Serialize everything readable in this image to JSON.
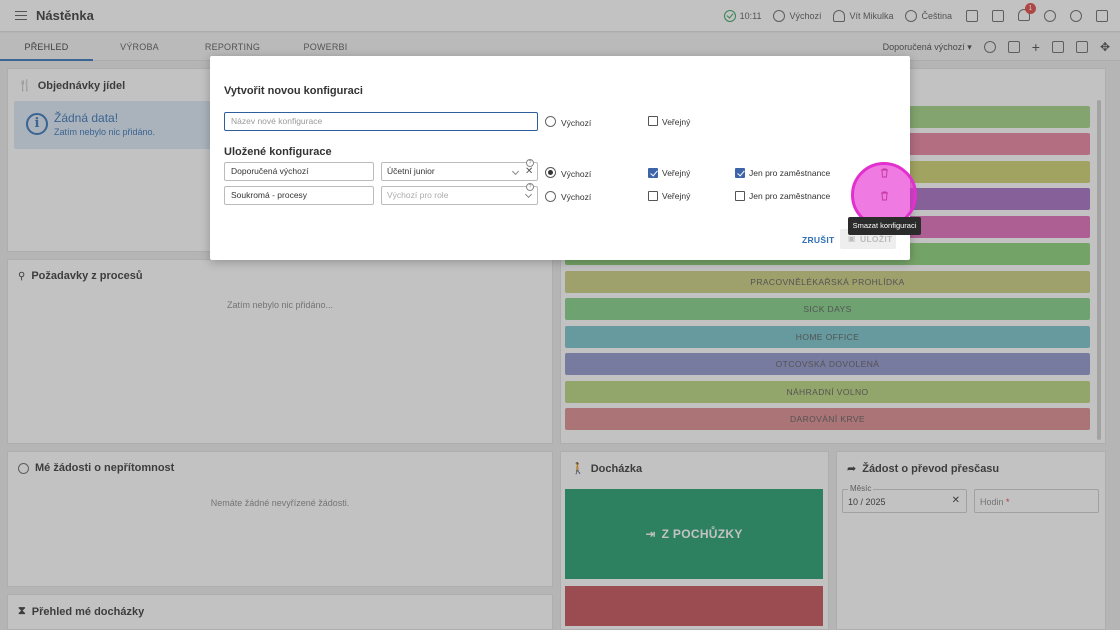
{
  "app": {
    "title": "Nástěnka"
  },
  "topbar": {
    "time": "10:11",
    "config_label": "Výchozí",
    "user": "Vít Mikulka",
    "language": "Čeština",
    "notifications_count": "1"
  },
  "tabs": [
    {
      "label": "PŘEHLED",
      "active": true
    },
    {
      "label": "VÝROBA",
      "active": false
    },
    {
      "label": "REPORTING",
      "active": false
    },
    {
      "label": "POWERBI",
      "active": false
    }
  ],
  "tab_right": {
    "config_select": "Doporučená výchozí"
  },
  "panels": {
    "orders": {
      "title": "Objednávky jídel",
      "info_title": "Žádná data!",
      "info_sub": "Zatím nebylo nic přidáno."
    },
    "requests": {
      "title": "Požadavky z procesů",
      "empty": "Zatím nebylo nic přidáno..."
    },
    "absence": {
      "title": "Mé žádosti o nepřítomnost",
      "empty": "Nemáte žádné nevyřízené žádosti."
    },
    "attendance_overview": {
      "title": "Přehled mé docházky"
    },
    "attendance": {
      "title": "Docházka",
      "button": "Z POCHŮZKY"
    },
    "overtime": {
      "title": "Žádost o převod přesčasu",
      "month_label": "Měsíc",
      "month_value": "10 / 2025",
      "hours_label": "Hodin",
      "required_mark": "*"
    }
  },
  "absence_types": [
    {
      "label": "",
      "color": "#9ed17f"
    },
    {
      "label": "",
      "color": "#e97e9c"
    },
    {
      "label": "",
      "color": "#cdd06a"
    },
    {
      "label": "",
      "color": "#a46bc0"
    },
    {
      "label": "",
      "color": "#df67b9"
    },
    {
      "label": "",
      "color": "#87cf73"
    },
    {
      "label": "PRACOVNĚLÉKAŘSKÁ PROHLÍDKA",
      "color": "#c8cd7c"
    },
    {
      "label": "SICK DAYS",
      "color": "#7fcf83"
    },
    {
      "label": "HOME OFFICE",
      "color": "#72c2c8"
    },
    {
      "label": "OTCOVSKÁ DOVOLENÁ",
      "color": "#8c93c9"
    },
    {
      "label": "NÁHRADNÍ VOLNO",
      "color": "#b5d47a"
    },
    {
      "label": "DAROVÁNÍ KRVE",
      "color": "#dc878a"
    }
  ],
  "dialog": {
    "title": "Vytvořit novou konfiguraci",
    "new_name_placeholder": "Název nové konfigurace",
    "default_label": "Výchozí",
    "public_label": "Veřejný",
    "employees_only_label": "Jen pro zaměstnance",
    "saved_title": "Uložené konfigurace",
    "rows": [
      {
        "name": "Doporučená výchozí",
        "role": "Účetní junior",
        "role_placeholder": "",
        "default": true,
        "public": true,
        "employees_only": true
      },
      {
        "name": "Soukromá - procesy",
        "role": "",
        "role_placeholder": "Výchozí pro role",
        "default": false,
        "public": false,
        "employees_only": false
      }
    ],
    "cancel": "ZRUŠIT",
    "save": "ULOŽIT",
    "tooltip": "Smazat konfiguraci"
  }
}
